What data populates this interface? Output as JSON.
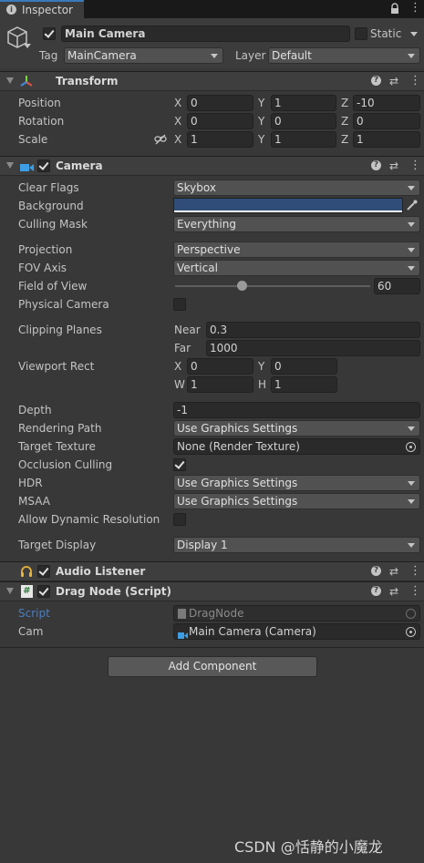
{
  "tab": {
    "label": "Inspector"
  },
  "gameobject": {
    "name": "Main Camera",
    "active": true,
    "static_label": "Static",
    "static": false,
    "tag_label": "Tag",
    "tag_value": "MainCamera",
    "layer_label": "Layer",
    "layer_value": "Default"
  },
  "transform": {
    "title": "Transform",
    "rows": [
      {
        "label": "Position",
        "x": "0",
        "y": "1",
        "z": "-10"
      },
      {
        "label": "Rotation",
        "x": "0",
        "y": "0",
        "z": "0"
      },
      {
        "label": "Scale",
        "x": "1",
        "y": "1",
        "z": "1"
      }
    ],
    "axes": {
      "x": "X",
      "y": "Y",
      "z": "Z"
    }
  },
  "camera": {
    "title": "Camera",
    "enabled": true,
    "clear_flags_label": "Clear Flags",
    "clear_flags": "Skybox",
    "background_label": "Background",
    "background_color": "#2f4d78",
    "culling_mask_label": "Culling Mask",
    "culling_mask": "Everything",
    "projection_label": "Projection",
    "projection": "Perspective",
    "fov_axis_label": "FOV Axis",
    "fov_axis": "Vertical",
    "fov_label": "Field of View",
    "fov_value": "60",
    "fov_slider_fraction": 0.34,
    "physical_label": "Physical Camera",
    "physical": false,
    "clipping_label": "Clipping Planes",
    "near_label": "Near",
    "near": "0.3",
    "far_label": "Far",
    "far": "1000",
    "viewport_label": "Viewport Rect",
    "vp_x_label": "X",
    "vp_x": "0",
    "vp_y_label": "Y",
    "vp_y": "0",
    "vp_w_label": "W",
    "vp_w": "1",
    "vp_h_label": "H",
    "vp_h": "1",
    "depth_label": "Depth",
    "depth": "-1",
    "rendering_path_label": "Rendering Path",
    "rendering_path": "Use Graphics Settings",
    "target_texture_label": "Target Texture",
    "target_texture": "None (Render Texture)",
    "occlusion_label": "Occlusion Culling",
    "occlusion": true,
    "hdr_label": "HDR",
    "hdr": "Use Graphics Settings",
    "msaa_label": "MSAA",
    "msaa": "Use Graphics Settings",
    "dynres_label": "Allow Dynamic Resolution",
    "dynres": false,
    "target_display_label": "Target Display",
    "target_display": "Display 1"
  },
  "audio_listener": {
    "title": "Audio Listener",
    "enabled": true
  },
  "drag_node": {
    "title": "Drag Node (Script)",
    "enabled": true,
    "script_label": "Script",
    "script_value": "DragNode",
    "cam_label": "Cam",
    "cam_value": "Main Camera (Camera)"
  },
  "add_component": "Add Component",
  "watermark": "CSDN @恬静的小魔龙",
  "colors": {
    "accent": "#3a79bb",
    "panel": "#383838",
    "header": "#3e3e3e"
  }
}
